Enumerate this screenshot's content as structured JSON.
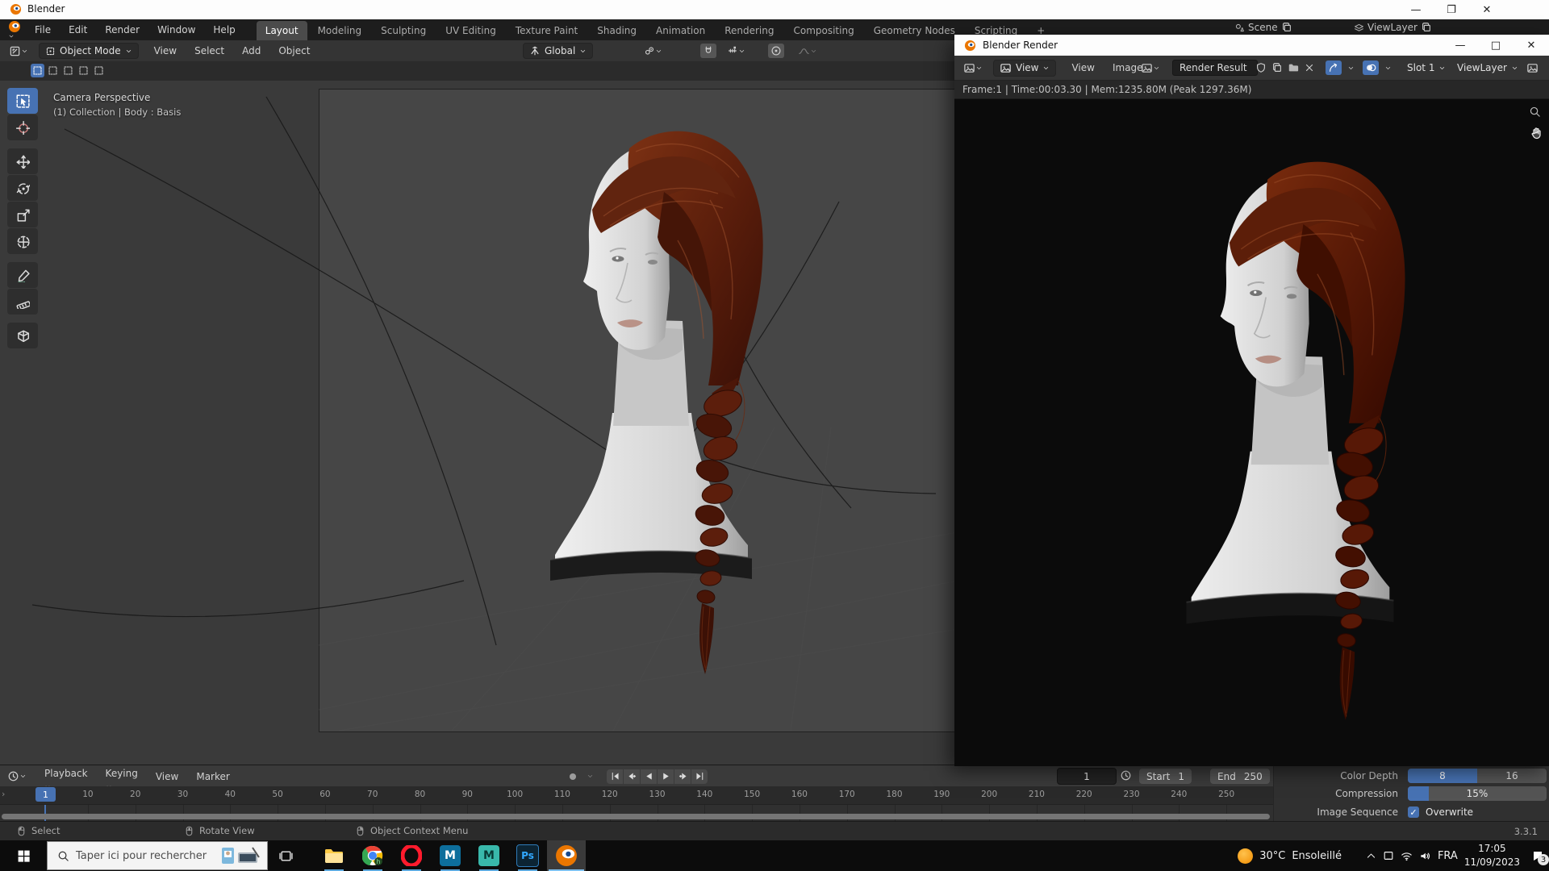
{
  "main_window": {
    "title": "Blender",
    "menubar": [
      "File",
      "Edit",
      "Render",
      "Window",
      "Help"
    ],
    "workspaces": [
      "Layout",
      "Modeling",
      "Sculpting",
      "UV Editing",
      "Texture Paint",
      "Shading",
      "Animation",
      "Rendering",
      "Compositing",
      "Geometry Nodes",
      "Scripting"
    ],
    "active_workspace": "Layout",
    "new_workspace_button": "+",
    "scene": "Scene",
    "view_layer": "ViewLayer"
  },
  "viewport": {
    "mode": "Object Mode",
    "menus": [
      "View",
      "Select",
      "Add",
      "Object"
    ],
    "orientation": "Global",
    "overlay_line1": "Camera Perspective",
    "overlay_line2": "(1) Collection | Body : Basis",
    "tools": [
      "select-box",
      "cursor",
      "move",
      "rotate",
      "scale",
      "transform",
      "annotate",
      "measure",
      "add-cube"
    ]
  },
  "render_window": {
    "title": "Blender Render",
    "display_mode": "View",
    "menus": [
      "View",
      "Image"
    ],
    "image_name": "Render Result",
    "slot": "Slot 1",
    "view_layer": "ViewLayer",
    "stats": "Frame:1 | Time:00:03.30 | Mem:1235.80M (Peak 1297.36M)"
  },
  "timeline": {
    "menus": [
      "Playback",
      "Keying",
      "View",
      "Marker"
    ],
    "current_frame": "1",
    "start_label": "Start",
    "start_value": "1",
    "end_label": "End",
    "end_value": "250",
    "ticks": [
      10,
      20,
      30,
      40,
      50,
      60,
      70,
      80,
      90,
      100,
      110,
      120,
      130,
      140,
      150,
      160,
      170,
      180,
      190,
      200,
      210,
      220,
      230,
      240,
      250
    ]
  },
  "output_properties": {
    "color_depth_label": "Color Depth",
    "depth_options": [
      "8",
      "16"
    ],
    "selected_depth": "8",
    "compression_label": "Compression",
    "compression_value": "15%",
    "image_sequence_label": "Image Sequence",
    "overwrite_label": "Overwrite",
    "overwrite_checked": true
  },
  "status_bar": {
    "left_hint": "Select",
    "middle_hint": "Rotate View",
    "right_hint": "Object Context Menu",
    "version": "3.3.1"
  },
  "taskbar": {
    "search_placeholder": "Taper ici pour rechercher",
    "apps": [
      "file-explorer",
      "chrome",
      "opera",
      "maya-blue",
      "maya-teal",
      "photoshop",
      "blender"
    ],
    "weather_temp": "30°C",
    "weather_desc": "Ensoleillé",
    "language": "FRA",
    "time": "17:05",
    "date": "11/09/2023",
    "notification_count": "3"
  },
  "colors": {
    "accent": "#4772b3",
    "taskbar_underline": "#5ca8dd",
    "hair": "#5a1d0c",
    "skin": "#dedede",
    "blender_orange": "#ea7600"
  }
}
